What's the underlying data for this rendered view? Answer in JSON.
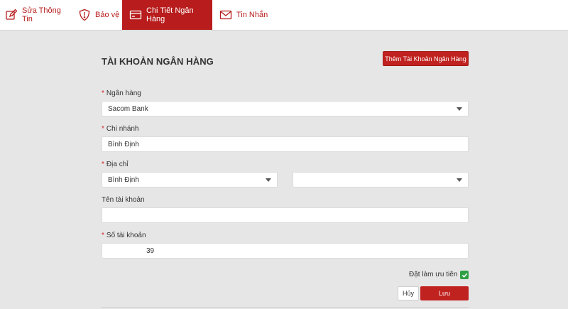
{
  "tabs": [
    {
      "label": "Sửa Thông Tin",
      "icon": "edit-icon"
    },
    {
      "label": "Bảo vệ",
      "icon": "shield-icon"
    },
    {
      "label": "Chi Tiết Ngân Hàng",
      "icon": "bank-card-icon",
      "active": true
    },
    {
      "label": "Tin Nhắn",
      "icon": "mail-icon"
    }
  ],
  "colors": {
    "accent": "#b81c1c",
    "success": "#2ea043",
    "background": "#e6e6e6"
  },
  "section": {
    "title": "TÀI KHOẢN NGÂN HÀNG",
    "add_button": "Thêm Tài Khoản Ngân Hàng"
  },
  "form": {
    "bank": {
      "label": "Ngân hàng",
      "required": true,
      "value": "Sacom Bank"
    },
    "branch": {
      "label": "Chi nhánh",
      "required": true,
      "value": "Bình Định"
    },
    "address": {
      "label": "Địa chỉ",
      "required": true,
      "province": "Bình Định",
      "district": ""
    },
    "account_name": {
      "label": "Tên tài khoản",
      "required": false,
      "value": ""
    },
    "account_number": {
      "label": "Số tài khoản",
      "required": true,
      "value": "39"
    },
    "priority": {
      "label": "Đặt làm ưu tiên",
      "checked": true
    },
    "cancel_button": "Hủy",
    "save_button": "Lưu"
  }
}
